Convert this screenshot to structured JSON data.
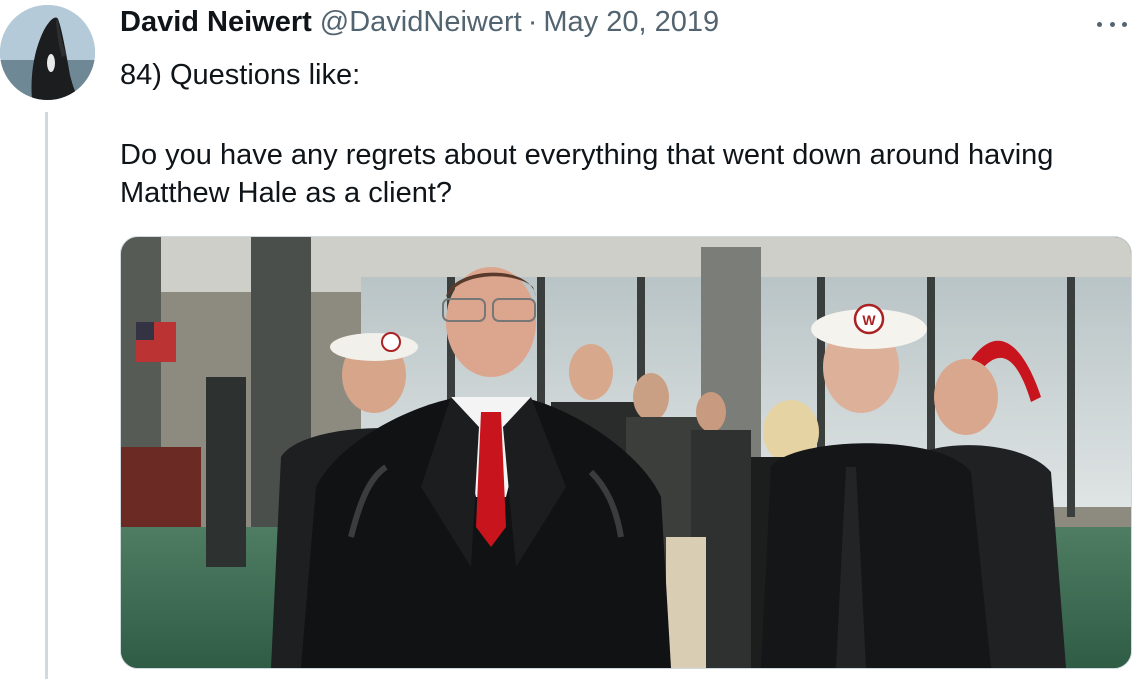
{
  "tweet": {
    "author_name": "David Neiwert",
    "author_handle": "@DavidNeiwert",
    "separator": "·",
    "date": "May 20, 2019",
    "text_line1": "84) Questions like:",
    "text_line2": "Do you have any regrets about everything that went down around having Matthew Hale as a client?"
  },
  "media": {
    "cap_emblem_letter": "W"
  },
  "icons": {
    "more": "more-options-icon",
    "avatar": "orca-avatar-icon"
  },
  "colors": {
    "text_primary": "#0f1419",
    "text_secondary": "#536471",
    "thread_line": "#cfd9de",
    "tie_red": "#c8141c"
  }
}
